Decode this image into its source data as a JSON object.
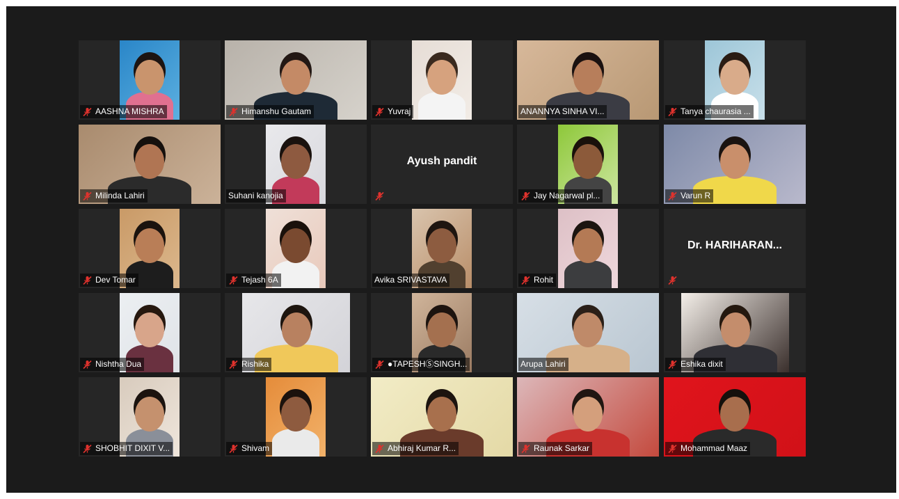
{
  "participants": [
    {
      "name": "AASHNA MISHRA",
      "muted": true,
      "video": {
        "type": "narrow",
        "bg": "#2a86c8",
        "bg2": "#5cb0e0",
        "skin": "#c9946d",
        "hair": "#1c1412",
        "shirt": "#e07090"
      }
    },
    {
      "name": "Himanshu Gautam",
      "muted": true,
      "video": {
        "type": "full",
        "bg": "#b8b2aa",
        "bg2": "#d6d2cb",
        "skin": "#c48a66",
        "hair": "#231814",
        "shirt": "#1e2a36"
      }
    },
    {
      "name": "Yuvraj",
      "muted": true,
      "video": {
        "type": "narrow",
        "bg": "#e6ddd6",
        "bg2": "#f2ece6",
        "skin": "#d6a27e",
        "hair": "#3a2a1f",
        "shirt": "#f4f4f4"
      }
    },
    {
      "name": "ANANNYA SINHA VI...",
      "muted": false,
      "speaking": true,
      "video": {
        "type": "full",
        "bg": "#d7b89a",
        "bg2": "#b89874",
        "skin": "#b77e5b",
        "hair": "#1a1110",
        "shirt": "#3b3c44"
      }
    },
    {
      "name": "Tanya chaurasia ...",
      "muted": true,
      "video": {
        "type": "narrow",
        "bg": "#9dc6d8",
        "bg2": "#c9e0ea",
        "skin": "#d9ab8a",
        "hair": "#2a1c14",
        "shirt": "#ffffff"
      }
    },
    {
      "name": "Milinda Lahiri",
      "muted": true,
      "video": {
        "type": "full",
        "bg": "#a98b6e",
        "bg2": "#cbb299",
        "skin": "#b07553",
        "hair": "#15100d",
        "shirt": "#2b2b2b"
      }
    },
    {
      "name": "Suhani kanojia",
      "muted": false,
      "video": {
        "type": "narrow",
        "bg": "#e9e9ec",
        "bg2": "#d8d8dd",
        "skin": "#8e5a40",
        "hair": "#1a120e",
        "shirt": "#c23a5a"
      }
    },
    {
      "name": "Ayush pandit",
      "muted": true,
      "video": null
    },
    {
      "name": "Jay Nagarwal pl...",
      "muted": true,
      "video": {
        "type": "narrow",
        "bg": "#8ec83a",
        "bg2": "#cde6a0",
        "skin": "#8c5a3a",
        "hair": "#1a110b",
        "shirt": "#444444"
      }
    },
    {
      "name": "Varun R",
      "muted": true,
      "video": {
        "type": "full",
        "bg": "#7e8aa8",
        "bg2": "#b9b9cc",
        "skin": "#c98f6b",
        "hair": "#1a1310",
        "shirt": "#f0d84a"
      }
    },
    {
      "name": "Dev Tomar",
      "muted": true,
      "video": {
        "type": "narrow",
        "bg": "#c99a67",
        "bg2": "#dcb88d",
        "skin": "#b97e57",
        "hair": "#1b130e",
        "shirt": "#1d1d1d"
      }
    },
    {
      "name": "Tejash 6A",
      "muted": true,
      "video": {
        "type": "narrow",
        "bg": "#efe0d8",
        "bg2": "#e8c9bb",
        "skin": "#7a4a30",
        "hair": "#1a110b",
        "shirt": "#f2f2f2"
      }
    },
    {
      "name": "Avika SRIVASTAVA",
      "muted": false,
      "video": {
        "type": "narrow",
        "bg": "#d9c4ad",
        "bg2": "#b98e69",
        "skin": "#8d5c40",
        "hair": "#1e1510",
        "shirt": "#51402f"
      }
    },
    {
      "name": "Rohit",
      "muted": true,
      "video": {
        "type": "narrow",
        "bg": "#ddc0c6",
        "bg2": "#efd8dc",
        "skin": "#b47a55",
        "hair": "#1c1510",
        "shirt": "#3c3d3f"
      }
    },
    {
      "name": "Dr. HARIHARAN...",
      "muted": true,
      "video": null
    },
    {
      "name": "Nishtha Dua",
      "muted": true,
      "video": {
        "type": "narrow",
        "bg": "#eceff2",
        "bg2": "#dfe3e7",
        "skin": "#d8a58a",
        "hair": "#26180f",
        "shirt": "#6a3140"
      }
    },
    {
      "name": "Rishika",
      "muted": true,
      "video": {
        "type": "mid",
        "bg": "#e7e7ea",
        "bg2": "#d3d3d8",
        "skin": "#b88160",
        "hair": "#1d150f",
        "shirt": "#f0c85a"
      }
    },
    {
      "name": "●TAPESHⓈSINGH...",
      "muted": true,
      "video": {
        "type": "narrow",
        "bg": "#d0b59b",
        "bg2": "#9b7b62",
        "skin": "#a4704f",
        "hair": "#1d140f",
        "shirt": "#2a2a2a"
      }
    },
    {
      "name": "Arupa Lahiri",
      "muted": false,
      "video": {
        "type": "full",
        "bg": "#d7dfe6",
        "bg2": "#b9c6d1",
        "skin": "#bf8a69",
        "hair": "#2a1f18",
        "shirt": "#d6b089"
      }
    },
    {
      "name": "Eshika dixit",
      "muted": true,
      "video": {
        "type": "mid",
        "bg": "#f4efe9",
        "bg2": "#3a2f2c",
        "skin": "#c48d6c",
        "hair": "#24180f",
        "shirt": "#2f2f35"
      }
    },
    {
      "name": "SHOBHIT DIXIT V...",
      "muted": true,
      "video": {
        "type": "narrow",
        "bg": "#d8cbbd",
        "bg2": "#efe6dc",
        "skin": "#c5916e",
        "hair": "#1b130f",
        "shirt": "#8a8f99"
      }
    },
    {
      "name": "Shivam",
      "muted": true,
      "video": {
        "type": "narrow",
        "bg": "#e58c3a",
        "bg2": "#f2b26a",
        "skin": "#8e5b3f",
        "hair": "#1b120d",
        "shirt": "#eaeaea"
      }
    },
    {
      "name": "Abhiraj Kumar R...",
      "muted": true,
      "video": {
        "type": "full",
        "bg": "#f2ecc6",
        "bg2": "#e4d9a6",
        "skin": "#a8704d",
        "hair": "#1c140f",
        "shirt": "#6a3b2b"
      }
    },
    {
      "name": "Raunak Sarkar",
      "muted": true,
      "video": {
        "type": "full",
        "bg": "#dcb7b9",
        "bg2": "#c44a3e",
        "skin": "#d49f7c",
        "hair": "#201611",
        "shirt": "#c8322f"
      }
    },
    {
      "name": "Mohammad Maaz",
      "muted": true,
      "video": {
        "type": "full",
        "bg": "#e0141c",
        "bg2": "#d11118",
        "skin": "#a86e4d",
        "hair": "#15100c",
        "shirt": "#2a2a2a"
      }
    }
  ]
}
